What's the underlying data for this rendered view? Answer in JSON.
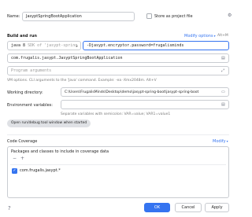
{
  "name": {
    "label": "Name:",
    "value": "JasyptSpringBootApplication",
    "store_label": "Store as project file"
  },
  "build_run": {
    "title": "Build and run",
    "modify_options": "Modify options",
    "shortcut": "Alt+M",
    "jdk": "java 8",
    "jdk_detail": "SDK of 'jasypt-spring",
    "vm_options": "-Djasypt.encryptor.password=frugalisminds",
    "main_class": "com.frugalis.jasypt.JasyptSpringBootApplication",
    "args_placeholder": "Program arguments",
    "vm_hint": "VM options. CLI arguments to the 'Java' command. Example: -ea -Xmx2048m. Alt+V"
  },
  "working_dir": {
    "label": "Working directory:",
    "value": "C:\\Users\\FrugalisMinds\\Desktop\\demo\\jasypt-spring-boot\\jasypt-spring-boot"
  },
  "env": {
    "label": "Environment variables:",
    "hint": "Separate variables with semicolon: VAR=value; VAR1=value1"
  },
  "run_window_chip": "Open run/debug tool window when started",
  "coverage": {
    "title": "Code Coverage",
    "modify": "Modify",
    "packages_label": "Packages and classes to include in coverage data",
    "item": "com.frugalis.jasypt.*"
  },
  "buttons": {
    "ok": "OK",
    "cancel": "Cancel",
    "apply": "Apply"
  },
  "colors": {
    "accent": "#3574f0"
  }
}
